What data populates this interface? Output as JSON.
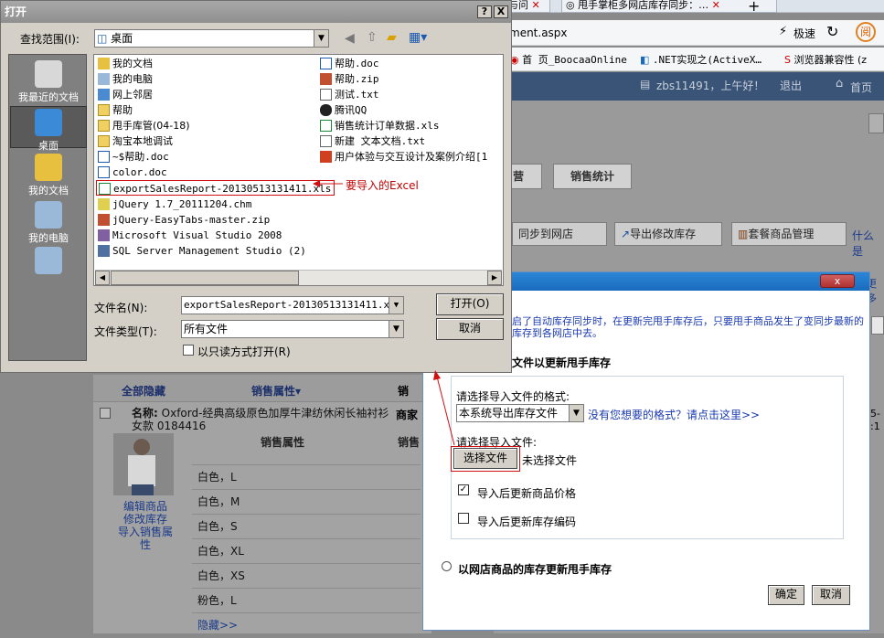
{
  "browser": {
    "tabs": [
      "手与问",
      "甩手掌柜多网店库存同步：…"
    ],
    "address": "gement.aspx",
    "speed_label": "极速",
    "favorites": [
      "首 页_BoocaaOnline",
      ".NET实现之(ActiveX…",
      "浏览器兼容性 (z"
    ],
    "user_greeting": "zbs11491，上午好！",
    "logout": "退出",
    "home": "首页"
  },
  "page": {
    "nav_buttons": [
      "营",
      "销售统计"
    ],
    "toolbar": [
      "同步到网店",
      "导出修改库存",
      "套餐商品管理"
    ],
    "toolbar_link": "什么是",
    "more_link": "更多",
    "list_header": {
      "hide_all": "全部隐藏",
      "sales_attr": "销售属性▾",
      "sales": "销"
    },
    "product": {
      "label": "名称:",
      "name": "Oxford-经典高级原色加厚牛津纺休闲长袖衬衫女款 0184416",
      "merchant": "商家",
      "right_partial": [
        "5-",
        ":1"
      ]
    },
    "sub_header": {
      "attr": "销售属性",
      "sales": "销售"
    },
    "product_links": [
      "编辑商品",
      "修改库存",
      "导入销售属性"
    ],
    "variants": [
      "白色，L",
      "白色，M",
      "白色，S",
      "白色，XL",
      "白色，XS",
      "粉色，L"
    ],
    "hidden_link": "隐藏>>"
  },
  "open_dialog": {
    "title": "打开",
    "help": "?",
    "close": "X",
    "look_in_label": "查找范围(I):",
    "look_in_value": "桌面",
    "places": [
      "我最近的文档",
      "桌面",
      "我的文档",
      "我的电脑",
      ""
    ],
    "files_col1": [
      "我的文档",
      "我的电脑",
      "网上邻居",
      "帮助",
      "甩手库管(04-18)",
      "淘宝本地调试",
      "~$帮助.doc",
      "color.doc",
      "exportSalesReport-20130513131411.xls",
      "jQuery 1.7_20111204.chm",
      "jQuery-EasyTabs-master.zip",
      "Microsoft Visual Studio 2008",
      "SQL Server Management Studio (2)"
    ],
    "files_col2": [
      "帮助.doc",
      "帮助.zip",
      "测试.txt",
      "腾讯QQ",
      "销售统计订单数据.xls",
      "新建 文本文档.txt",
      "用户体验与交互设计及案例介绍[1"
    ],
    "filename_label": "文件名(N):",
    "filename_value": "exportSalesReport-20130513131411.xls",
    "filetype_label": "文件类型(T):",
    "filetype_value": "所有文件",
    "readonly_label": "以只读方式打开(R)",
    "open_button": "打开(O)",
    "cancel_button": "取消"
  },
  "annotation": "要导入的Excel",
  "import_dialog": {
    "close": "x",
    "notice": "启了自动库存同步时，在更新完甩手库存后，只要甩手商品发生了变同步最新的库存到各网店中去。",
    "section_title": "文件以更新甩手库存",
    "format_label": "请选择导入文件的格式:",
    "format_value": "本系统导出库存文件",
    "format_link": "没有您想要的格式？请点击这里>>",
    "file_label": "请选择导入文件:",
    "choose_button": "选择文件",
    "no_file": "未选择文件",
    "check_price": "导入后更新商品价格",
    "check_code": "导入后更新库存编码",
    "radio_shop": "以网店商品的库存更新甩手库存",
    "ok": "确定",
    "cancel": "取消"
  }
}
